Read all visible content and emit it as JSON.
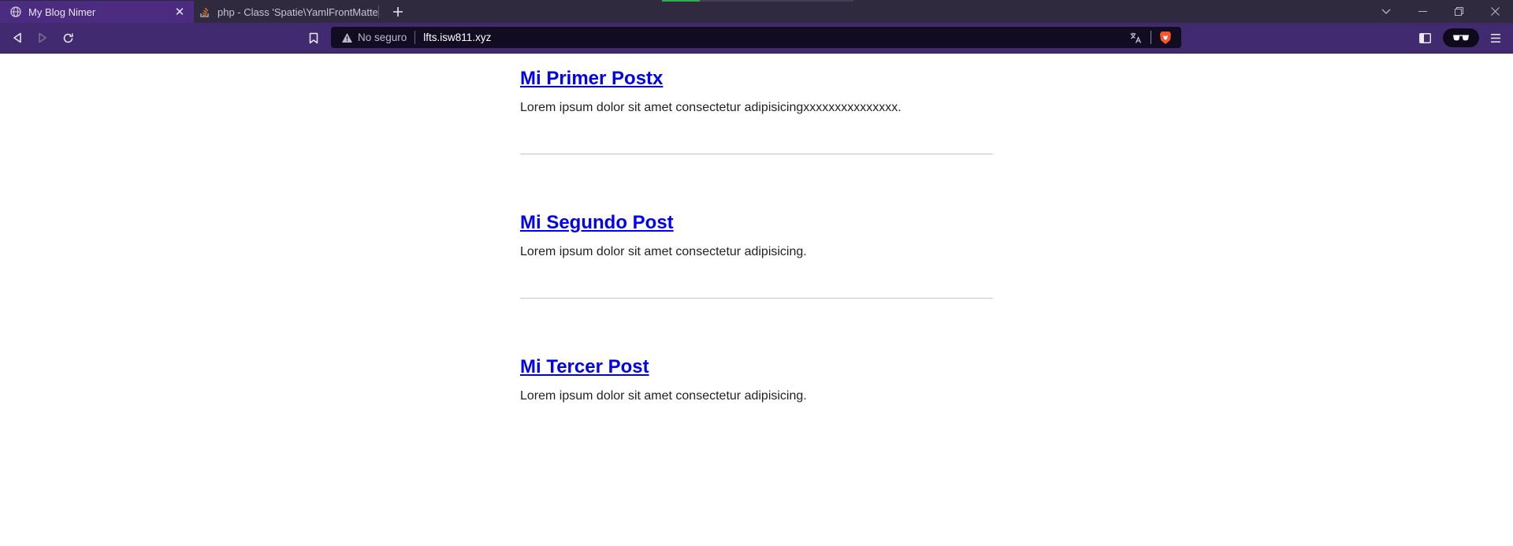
{
  "browser": {
    "tabs": [
      {
        "title": "My Blog Nimer",
        "favicon": "globe-icon",
        "active": true
      },
      {
        "title": "php - Class 'Spatie\\YamlFrontMatter\\Y",
        "favicon": "stackoverflow-icon",
        "active": false
      }
    ],
    "address_bar": {
      "security_label": "No seguro",
      "url": "lfts.isw811.xyz"
    },
    "colors": {
      "tabstrip": "#302a3f",
      "active_tab": "#4b2c80",
      "toolbar": "#412a70",
      "omnibox": "#110c21",
      "brave_orange": "#fb542b"
    }
  },
  "page": {
    "posts": [
      {
        "title": "Mi Primer Postx",
        "excerpt": "Lorem ipsum dolor sit amet consectetur adipisicingxxxxxxxxxxxxxxx."
      },
      {
        "title": "Mi Segundo Post",
        "excerpt": "Lorem ipsum dolor sit amet consectetur adipisicing."
      },
      {
        "title": "Mi Tercer Post",
        "excerpt": "Lorem ipsum dolor sit amet consectetur adipisicing."
      }
    ],
    "link_color": "#0000ee"
  }
}
